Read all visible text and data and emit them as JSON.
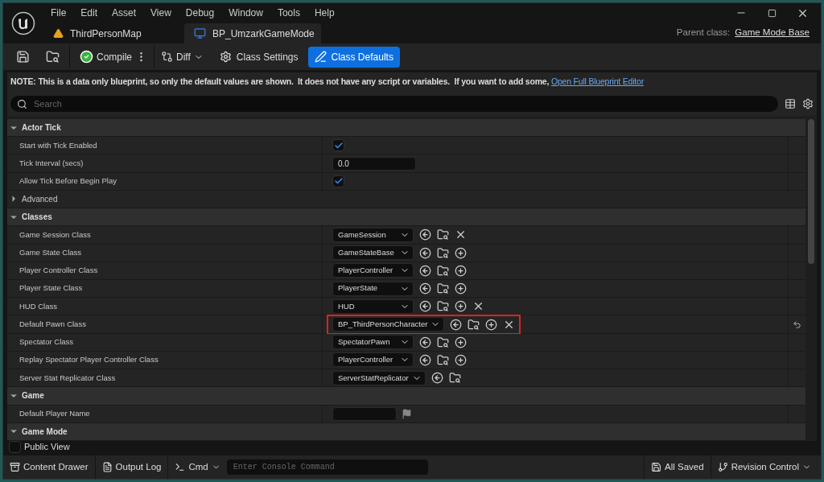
{
  "menu": [
    "File",
    "Edit",
    "Asset",
    "View",
    "Debug",
    "Window",
    "Tools",
    "Help"
  ],
  "tabs": [
    {
      "label": "ThirdPersonMap",
      "selected": false,
      "kind": "map"
    },
    {
      "label": "BP_UmzarkGameMode",
      "selected": true,
      "kind": "blueprint"
    }
  ],
  "parent_class": {
    "label": "Parent class:",
    "value": "Game Mode Base"
  },
  "toolbar": [
    {
      "kind": "save"
    },
    {
      "kind": "browse"
    },
    {
      "kind": "compile",
      "label": "Compile"
    },
    {
      "kind": "diff",
      "label": "Diff"
    },
    {
      "kind": "settings",
      "label": "Class Settings",
      "selected": false
    },
    {
      "kind": "defaults",
      "label": "Class Defaults",
      "selected": true
    }
  ],
  "note": {
    "text": "NOTE: This is a data only blueprint, so only the default values are shown.  It does not have any script or variables.  If you want to add some,",
    "link": "Open Full Blueprint Editor"
  },
  "search": {
    "placeholder": "Search"
  },
  "categories": [
    {
      "title": "Actor Tick",
      "expanded": true,
      "children": [
        {
          "kind": "checkbox",
          "label": "Start with Tick Enabled",
          "checked": true
        },
        {
          "kind": "number",
          "label": "Tick Interval (secs)",
          "value": "0.0"
        },
        {
          "kind": "checkbox",
          "label": "Allow Tick Before Begin Play",
          "checked": true
        },
        {
          "kind": "group",
          "label": "Advanced",
          "expanded": false
        }
      ]
    },
    {
      "title": "Classes",
      "expanded": true,
      "children": [
        {
          "kind": "class",
          "label": "Game Session Class",
          "value": "GameSession",
          "buttons": [
            {
              "kind": "use"
            },
            {
              "kind": "browse"
            },
            {
              "kind": "clear"
            }
          ]
        },
        {
          "kind": "class",
          "label": "Game State Class",
          "value": "GameStateBase",
          "buttons": [
            {
              "kind": "use"
            },
            {
              "kind": "browse"
            },
            {
              "kind": "add"
            }
          ]
        },
        {
          "kind": "class",
          "label": "Player Controller Class",
          "value": "PlayerController",
          "buttons": [
            {
              "kind": "use"
            },
            {
              "kind": "browse"
            },
            {
              "kind": "add"
            }
          ]
        },
        {
          "kind": "class",
          "label": "Player State Class",
          "value": "PlayerState",
          "buttons": [
            {
              "kind": "use"
            },
            {
              "kind": "browse"
            },
            {
              "kind": "add"
            }
          ]
        },
        {
          "kind": "class",
          "label": "HUD Class",
          "value": "HUD",
          "buttons": [
            {
              "kind": "use"
            },
            {
              "kind": "browse"
            },
            {
              "kind": "add"
            },
            {
              "kind": "clear"
            }
          ]
        },
        {
          "kind": "class",
          "label": "Default Pawn Class",
          "value": "BP_ThirdPersonCharacter",
          "buttons": [
            {
              "kind": "use"
            },
            {
              "kind": "browse"
            },
            {
              "kind": "add"
            },
            {
              "kind": "clear"
            }
          ],
          "highlighted": true,
          "reset": true
        },
        {
          "kind": "class",
          "label": "Spectator Class",
          "value": "SpectatorPawn",
          "buttons": [
            {
              "kind": "use"
            },
            {
              "kind": "browse"
            },
            {
              "kind": "add"
            }
          ]
        },
        {
          "kind": "class",
          "label": "Replay Spectator Player Controller Class",
          "value": "PlayerController",
          "buttons": [
            {
              "kind": "use"
            },
            {
              "kind": "browse"
            },
            {
              "kind": "add"
            }
          ]
        },
        {
          "kind": "class",
          "label": "Server Stat Replicator Class",
          "value": "ServerStatReplicator",
          "buttons": [
            {
              "kind": "use"
            },
            {
              "kind": "browse"
            }
          ]
        }
      ]
    },
    {
      "title": "Game",
      "expanded": true,
      "children": [
        {
          "kind": "text",
          "label": "Default Player Name"
        }
      ]
    },
    {
      "title": "Game Mode",
      "expanded": true
    }
  ],
  "public_view": {
    "label": "Public View",
    "checked": false
  },
  "status_bar": {
    "content_drawer": "Content Drawer",
    "output_log": "Output Log",
    "cmd": "Cmd",
    "console_placeholder": "Enter Console Command",
    "saved": "All Saved",
    "revision": "Revision Control"
  }
}
